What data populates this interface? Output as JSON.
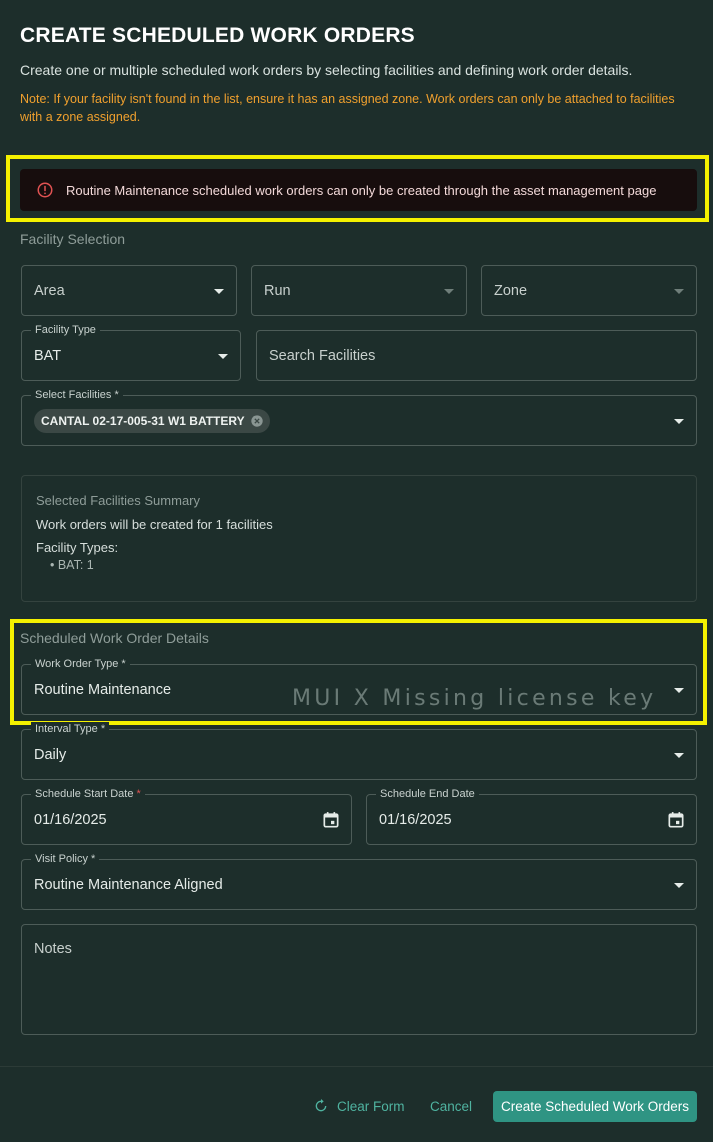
{
  "header": {
    "title": "CREATE SCHEDULED WORK ORDERS",
    "subtitle": "Create one or multiple scheduled work orders by selecting facilities and defining work order details.",
    "note": "Note: If your facility isn't found in the list, ensure it has an assigned zone. Work orders can only be attached to facilities with a zone assigned."
  },
  "alert": {
    "message": "Routine Maintenance scheduled work orders can only be created through the asset management page",
    "icon": "error-outline-icon"
  },
  "facility_selection": {
    "heading": "Facility Selection",
    "area_placeholder": "Area",
    "run_placeholder": "Run",
    "zone_placeholder": "Zone",
    "facility_type_label": "Facility Type",
    "facility_type_value": "BAT",
    "search_placeholder": "Search Facilities",
    "select_facilities_label": "Select Facilities",
    "selected_chip": "CANTAL 02-17-005-31 W1 BATTERY"
  },
  "summary": {
    "title": "Selected Facilities Summary",
    "line": "Work orders will be created for 1 facilities",
    "types_label": "Facility Types:",
    "types": [
      "• BAT: 1"
    ]
  },
  "details": {
    "heading": "Scheduled Work Order Details",
    "work_order_type_label": "Work Order Type",
    "work_order_type_value": "Routine Maintenance",
    "interval_type_label": "Interval Type",
    "interval_type_value": "Daily",
    "start_date_label": "Schedule Start Date",
    "start_date_value": "01/16/2025",
    "end_date_label": "Schedule End Date",
    "end_date_value": "01/16/2025",
    "visit_policy_label": "Visit Policy",
    "visit_policy_value": "Routine Maintenance Aligned",
    "notes_placeholder": "Notes",
    "required_mark": "*"
  },
  "watermark": "MUI X Missing license key",
  "footer": {
    "clear_label": "Clear Form",
    "cancel_label": "Cancel",
    "create_label": "Create Scheduled Work Orders"
  },
  "colors": {
    "background": "#1d2e2b",
    "accent": "#2f9483",
    "warning": "#f0a02e",
    "highlight": "#f4f100",
    "error": "#e05252"
  }
}
